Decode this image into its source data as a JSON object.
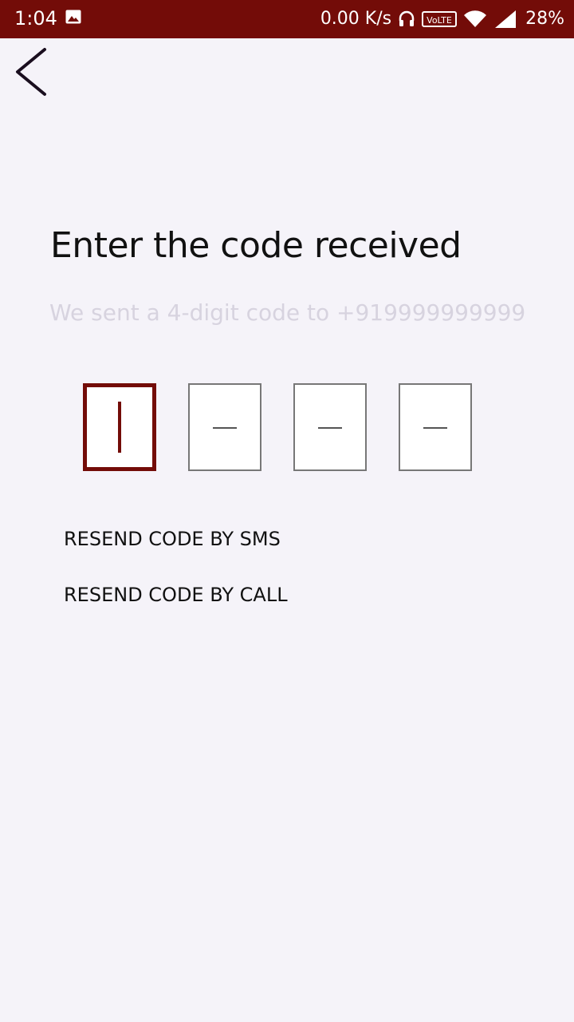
{
  "status_bar": {
    "time": "1:04",
    "net_speed": "0.00 K/s",
    "battery": "28%",
    "icons": [
      "photo-icon",
      "headset-icon",
      "volte-icon",
      "wifi-icon",
      "signal-icon"
    ],
    "background_color": "#730c08"
  },
  "header": {
    "back_icon": "chevron-left-icon"
  },
  "main": {
    "title": "Enter the code received",
    "subtitle": "We sent a 4-digit code to +919999999999",
    "code_boxes": [
      {
        "value": "",
        "active": true
      },
      {
        "value": "",
        "active": false
      },
      {
        "value": "",
        "active": false
      },
      {
        "value": "",
        "active": false
      }
    ],
    "resend_sms": "RESEND CODE BY SMS",
    "resend_call": "RESEND CODE BY CALL"
  },
  "colors": {
    "accent": "#730c08",
    "background": "#f5f3f9",
    "subtitle": "#d7d3df"
  }
}
